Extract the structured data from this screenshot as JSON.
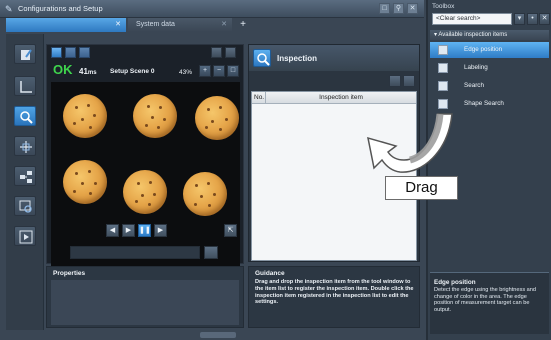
{
  "window": {
    "title": "Configurations and Setup"
  },
  "tabs": [
    {
      "label": ""
    },
    {
      "label": "System data"
    }
  ],
  "image_panel": {
    "status": "OK",
    "time_value": "41",
    "time_unit": "ms",
    "scene": "Setup Scene 0",
    "zoom": "43%"
  },
  "properties": {
    "title": "Properties"
  },
  "inspection": {
    "title": "Inspection",
    "columns": [
      "No.",
      "Inspection item"
    ]
  },
  "guidance": {
    "title": "Guidance",
    "text": "Drag and drop the inspection item from the tool window to the item list to register the inspection item. Double click the inspection item registered in the inspection list to edit the settings."
  },
  "toolbox": {
    "title": "Toolbox",
    "search_value": "<Clear search>",
    "category": "Available inspection items",
    "items": [
      {
        "label": "Edge position",
        "selected": true
      },
      {
        "label": "Labeling"
      },
      {
        "label": "Search"
      },
      {
        "label": "Shape Search"
      }
    ],
    "description_title": "Edge position",
    "description_text": "Detect the edge using the brightness and change of color in the area. The edge position of measurement target can be output."
  },
  "annotation": {
    "label": "Drag"
  }
}
